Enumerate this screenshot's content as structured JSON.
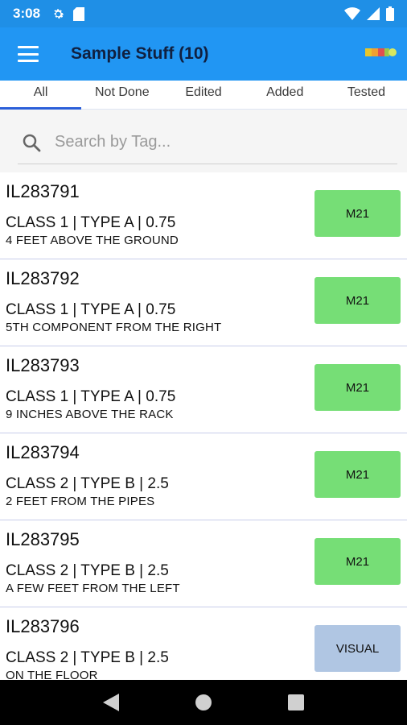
{
  "status_bar": {
    "time": "3:08",
    "icons": [
      "gear-icon",
      "sd-card-icon",
      "wifi-icon",
      "signal-icon",
      "battery-icon"
    ]
  },
  "app_bar": {
    "title": "Sample Stuff (10)",
    "menu_icon": "hamburger-menu-icon",
    "logo_icon": "app-logo-icon"
  },
  "tabs": [
    {
      "label": "All",
      "active": true
    },
    {
      "label": "Not Done",
      "active": false
    },
    {
      "label": "Edited",
      "active": false
    },
    {
      "label": "Added",
      "active": false
    },
    {
      "label": "Tested",
      "active": false
    }
  ],
  "search": {
    "placeholder": "Search by Tag...",
    "value": ""
  },
  "items": [
    {
      "tag": "IL283791",
      "class_line": "CLASS 1  |  TYPE A  |  0.75",
      "location": "4 FEET ABOVE THE GROUND",
      "button": "M21",
      "button_color": "#76de76"
    },
    {
      "tag": "IL283792",
      "class_line": "CLASS 1  |  TYPE A  |  0.75",
      "location": "5TH COMPONENT FROM THE RIGHT",
      "button": "M21",
      "button_color": "#76de76"
    },
    {
      "tag": "IL283793",
      "class_line": "CLASS 1  |  TYPE A  |  0.75",
      "location": "9 INCHES ABOVE THE RACK",
      "button": "M21",
      "button_color": "#76de76"
    },
    {
      "tag": "IL283794",
      "class_line": "CLASS 2  |  TYPE B  |  2.5",
      "location": "2 FEET FROM THE PIPES",
      "button": "M21",
      "button_color": "#76de76"
    },
    {
      "tag": "IL283795",
      "class_line": "CLASS 2  |  TYPE B  |  2.5",
      "location": "A FEW FEET FROM THE LEFT",
      "button": "M21",
      "button_color": "#76de76"
    },
    {
      "tag": "IL283796",
      "class_line": "CLASS 2  |  TYPE B  |  2.5",
      "location": "ON THE FLOOR",
      "button": "VISUAL",
      "button_color": "#b0c6e3"
    }
  ],
  "nav_bar": {
    "icons": [
      "back-icon",
      "home-icon",
      "recents-icon"
    ]
  },
  "colors": {
    "status_bar": "#1f8fe6",
    "app_bar": "#2196f3",
    "tab_indicator": "#2b5fd9",
    "button_green": "#76de76",
    "button_blue": "#b0c6e3"
  }
}
